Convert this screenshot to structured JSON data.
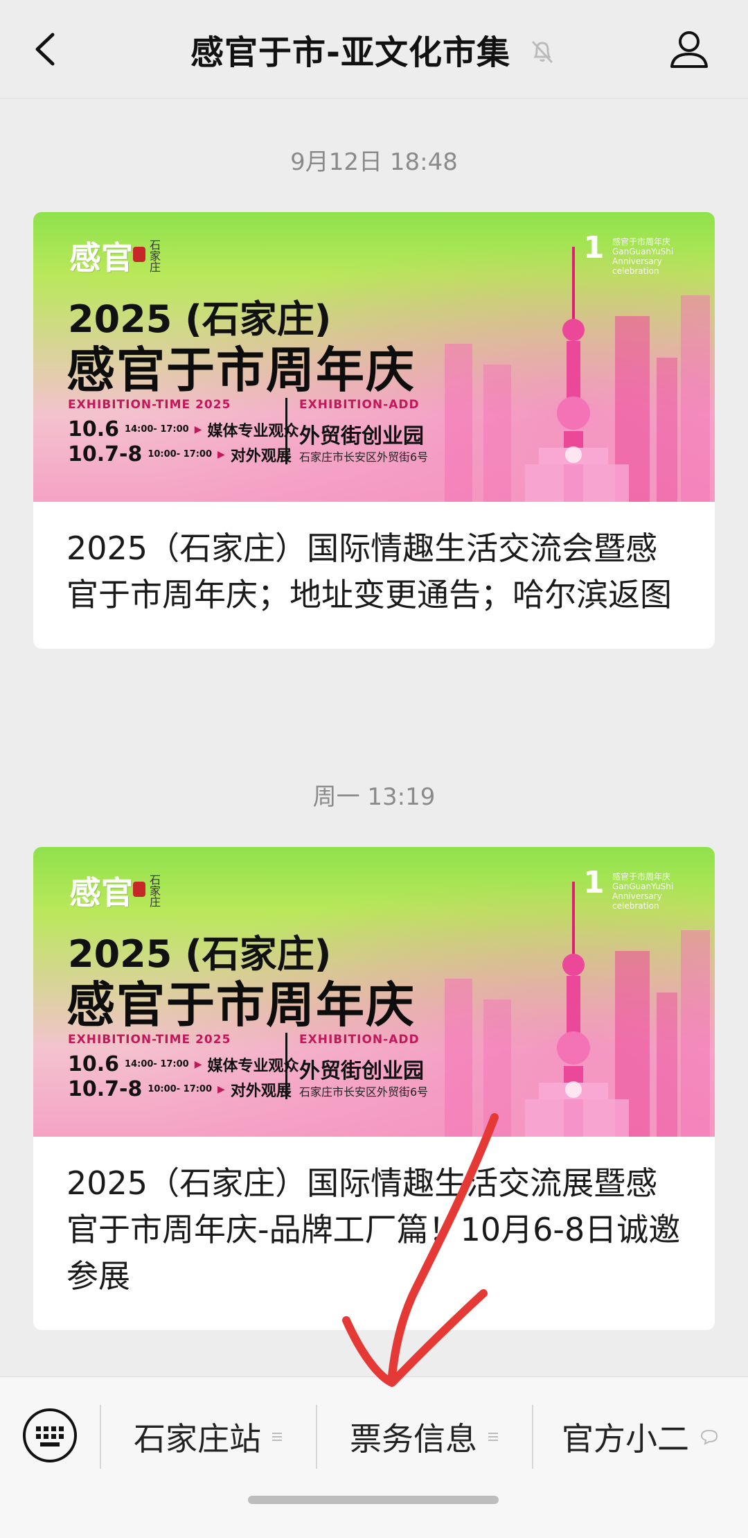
{
  "header": {
    "title": "感官于市-亚文化市集"
  },
  "messages": [
    {
      "timestamp": "9月12日 18:48",
      "article": {
        "banner": {
          "logo": "感官",
          "logo_side": "石家庄",
          "anniversary_number": "1",
          "anniversary_text": "感官于市周年庆 GanGuanYuShi Anniversary celebration",
          "year_line": "2025 (石家庄)",
          "main_line": "感官于市周年庆",
          "exhibition_time_label": "EXHIBITION-TIME 2025",
          "exhibition_add_label": "EXHIBITION-ADD",
          "row1_date": "10.6",
          "row1_time": "14:00- 17:00",
          "row1_desc": "媒体专业观众",
          "row2_date": "10.7-8",
          "row2_time": "10:00- 17:00",
          "row2_desc": "对外观展",
          "venue": "外贸街创业园",
          "address": "石家庄市长安区外贸街6号"
        },
        "title": "2025（石家庄）国际情趣生活交流会暨感官于市周年庆；地址变更通告；哈尔滨返图"
      }
    },
    {
      "timestamp": "周一 13:19",
      "article": {
        "banner": {
          "logo": "感官",
          "logo_side": "石家庄",
          "anniversary_number": "1",
          "anniversary_text": "感官于市周年庆 GanGuanYuShi Anniversary celebration",
          "year_line": "2025 (石家庄)",
          "main_line": "感官于市周年庆",
          "exhibition_time_label": "EXHIBITION-TIME 2025",
          "exhibition_add_label": "EXHIBITION-ADD",
          "row1_date": "10.6",
          "row1_time": "14:00- 17:00",
          "row1_desc": "媒体专业观众",
          "row2_date": "10.7-8",
          "row2_time": "10:00- 17:00",
          "row2_desc": "对外观展",
          "venue": "外贸街创业园",
          "address": "石家庄市长安区外贸街6号"
        },
        "title": "2025（石家庄）国际情趣生活交流展暨感官于市周年庆-品牌工厂篇！10月6-8日诚邀参展"
      }
    }
  ],
  "bottom_menu": {
    "items": [
      {
        "label": "石家庄站",
        "icon": "menu-lines-icon"
      },
      {
        "label": "票务信息",
        "icon": "menu-lines-icon"
      },
      {
        "label": "官方小二",
        "icon": "chat-bubble-icon"
      }
    ]
  },
  "colors": {
    "accent_pink": "#c2185b",
    "annotation_red": "#e53935"
  }
}
